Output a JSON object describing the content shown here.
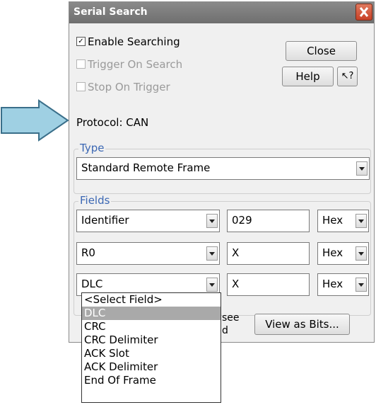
{
  "window": {
    "title": "Serial Search"
  },
  "options": {
    "enable_searching": {
      "label": "Enable Searching",
      "checked": true
    },
    "trigger_on_search": {
      "label": "Trigger On Search",
      "checked": false,
      "enabled": false
    },
    "stop_on_trigger": {
      "label": "Stop On Trigger",
      "checked": false,
      "enabled": false
    }
  },
  "buttons": {
    "close": "Close",
    "help": "Help",
    "context_help": "↖?",
    "view_as_bits": "View as Bits..."
  },
  "protocol": {
    "text": "Protocol: CAN"
  },
  "type_group": {
    "label": "Type",
    "selected": "Standard Remote Frame"
  },
  "fields_group": {
    "label": "Fields",
    "rows": [
      {
        "field": "Identifier",
        "value": "029",
        "format": "Hex"
      },
      {
        "field": "R0",
        "value": "X",
        "format": "Hex"
      },
      {
        "field": "DLC",
        "value": "X",
        "format": "Hex"
      }
    ]
  },
  "partially_hidden": {
    "see": "see",
    "d": "d"
  },
  "dropdown_list": {
    "items": [
      "<Select Field>",
      "DLC",
      "CRC",
      "CRC Delimiter",
      "ACK Slot",
      "ACK Delimiter",
      "End Of Frame"
    ],
    "selected_index": 1
  },
  "colors": {
    "arrow_fill": "#9fd0e3",
    "arrow_stroke": "#3a6f8a",
    "accent_label": "#3b67b3"
  }
}
